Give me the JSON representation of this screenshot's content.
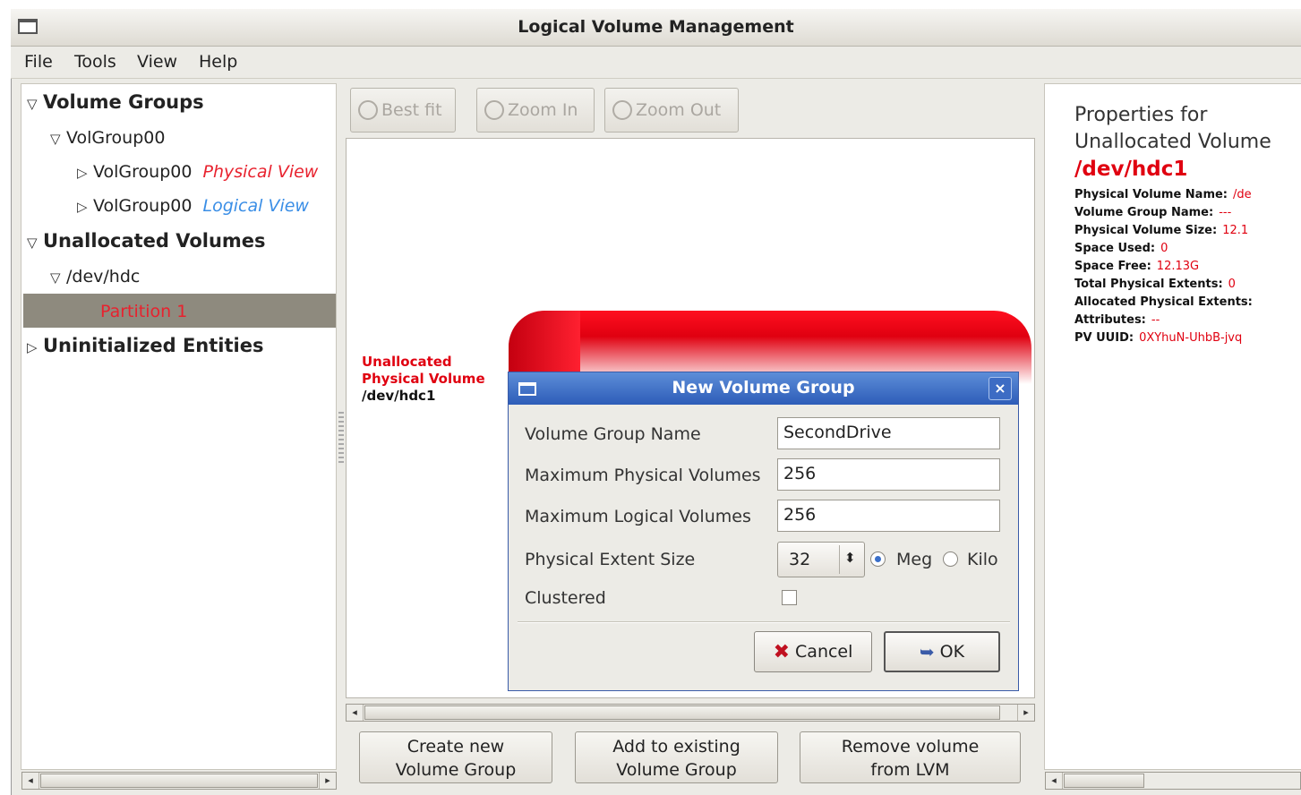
{
  "window": {
    "title": "Logical Volume Management"
  },
  "menu": {
    "items": [
      "File",
      "Tools",
      "View",
      "Help"
    ]
  },
  "tree": {
    "volume_groups": "Volume Groups",
    "volgroup": "VolGroup00",
    "physical_view_name": "VolGroup00",
    "physical_view_tag": "Physical View",
    "logical_view_name": "VolGroup00",
    "logical_view_tag": "Logical View",
    "unallocated_volumes": "Unallocated Volumes",
    "dev_hdc": "/dev/hdc",
    "partition": "Partition 1",
    "uninitialized": "Uninitialized Entities"
  },
  "toolbar": {
    "best_fit": "Best fit",
    "zoom_in": "Zoom In",
    "zoom_out": "Zoom Out"
  },
  "view": {
    "label_line1": "Unallocated",
    "label_line2": "Physical Volume",
    "label_line3": "/dev/hdc1"
  },
  "actions": {
    "create_line1": "Create new",
    "create_line2": "Volume Group",
    "add_line1": "Add to existing",
    "add_line2": "Volume Group",
    "remove_line1": "Remove volume",
    "remove_line2": "from LVM"
  },
  "properties": {
    "heading_line1": "Properties for",
    "heading_line2": "Unallocated Volume",
    "device": "/dev/hdc1",
    "rows": [
      {
        "label": "Physical Volume Name:",
        "value": "/de"
      },
      {
        "label": "Volume Group Name:",
        "value": "---"
      },
      {
        "label": "Physical Volume Size:",
        "value": "12.1"
      },
      {
        "label": "Space Used:",
        "value": "0"
      },
      {
        "label": "Space Free:",
        "value": "12.13G"
      },
      {
        "label": "Total Physical Extents:",
        "value": "0"
      },
      {
        "label": "Allocated Physical Extents:",
        "value": ""
      },
      {
        "label": "Attributes:",
        "value": "--"
      },
      {
        "label": "PV UUID:",
        "value": "0XYhuN-UhbB-jvq"
      }
    ]
  },
  "dialog": {
    "title": "New Volume Group",
    "close": "×",
    "vg_name_label": "Volume Group Name",
    "vg_name_value": "SecondDrive",
    "max_pv_label": "Maximum Physical Volumes",
    "max_pv_value": "256",
    "max_lv_label": "Maximum Logical Volumes",
    "max_lv_value": "256",
    "extent_label": "Physical Extent Size",
    "extent_value": "32",
    "unit_meg": "Meg",
    "unit_kilo": "Kilo",
    "unit_selected": "Meg",
    "clustered_label": "Clustered",
    "clustered_checked": false,
    "cancel": "Cancel",
    "ok": "OK"
  },
  "colors": {
    "accent_red": "#e00010",
    "logical_blue": "#3a8ee6",
    "dialog_title": "#2d5cb8",
    "selection": "#8e8a7e"
  },
  "icons": [
    "window-icon",
    "magnifier-icon",
    "triangle-expander-icon",
    "cancel-x-icon",
    "ok-arrow-icon",
    "close-icon"
  ]
}
